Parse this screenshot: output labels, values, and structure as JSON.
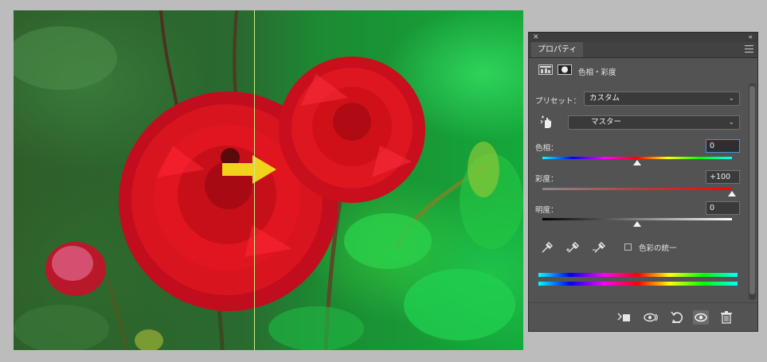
{
  "panel": {
    "tab_label": "プロパティ",
    "adjustment_label": "色相・彩度"
  },
  "preset": {
    "label": "プリセット：",
    "value": "カスタム"
  },
  "channel": {
    "value": "マスター"
  },
  "hue": {
    "label": "色相：",
    "value": "0",
    "level": 0.5
  },
  "saturation": {
    "label": "彩度：",
    "value": "+100",
    "level": 1.0
  },
  "lightness": {
    "label": "明度：",
    "value": "0",
    "level": 0.5
  },
  "colorize": {
    "label": "色彩の統一",
    "checked": false
  },
  "icons": {
    "close": "close-icon",
    "collapse": "collapse-icon",
    "menu": "panel-menu-icon",
    "adjustment_layer": "hue-saturation-icon",
    "mask": "mask-icon",
    "targeted_adjust": "hand-targeted-adjustment-icon",
    "eyedroppers": [
      "eyedropper-icon",
      "eyedropper-add-icon",
      "eyedropper-subtract-icon"
    ],
    "footer": [
      "clip-to-layer-icon",
      "view-previous-state-icon",
      "reset-icon",
      "visibility-icon",
      "trash-icon"
    ]
  },
  "colors": {
    "accent": "#4a90d9",
    "panel_bg": "#535353",
    "arrow": "#f2d21a"
  }
}
